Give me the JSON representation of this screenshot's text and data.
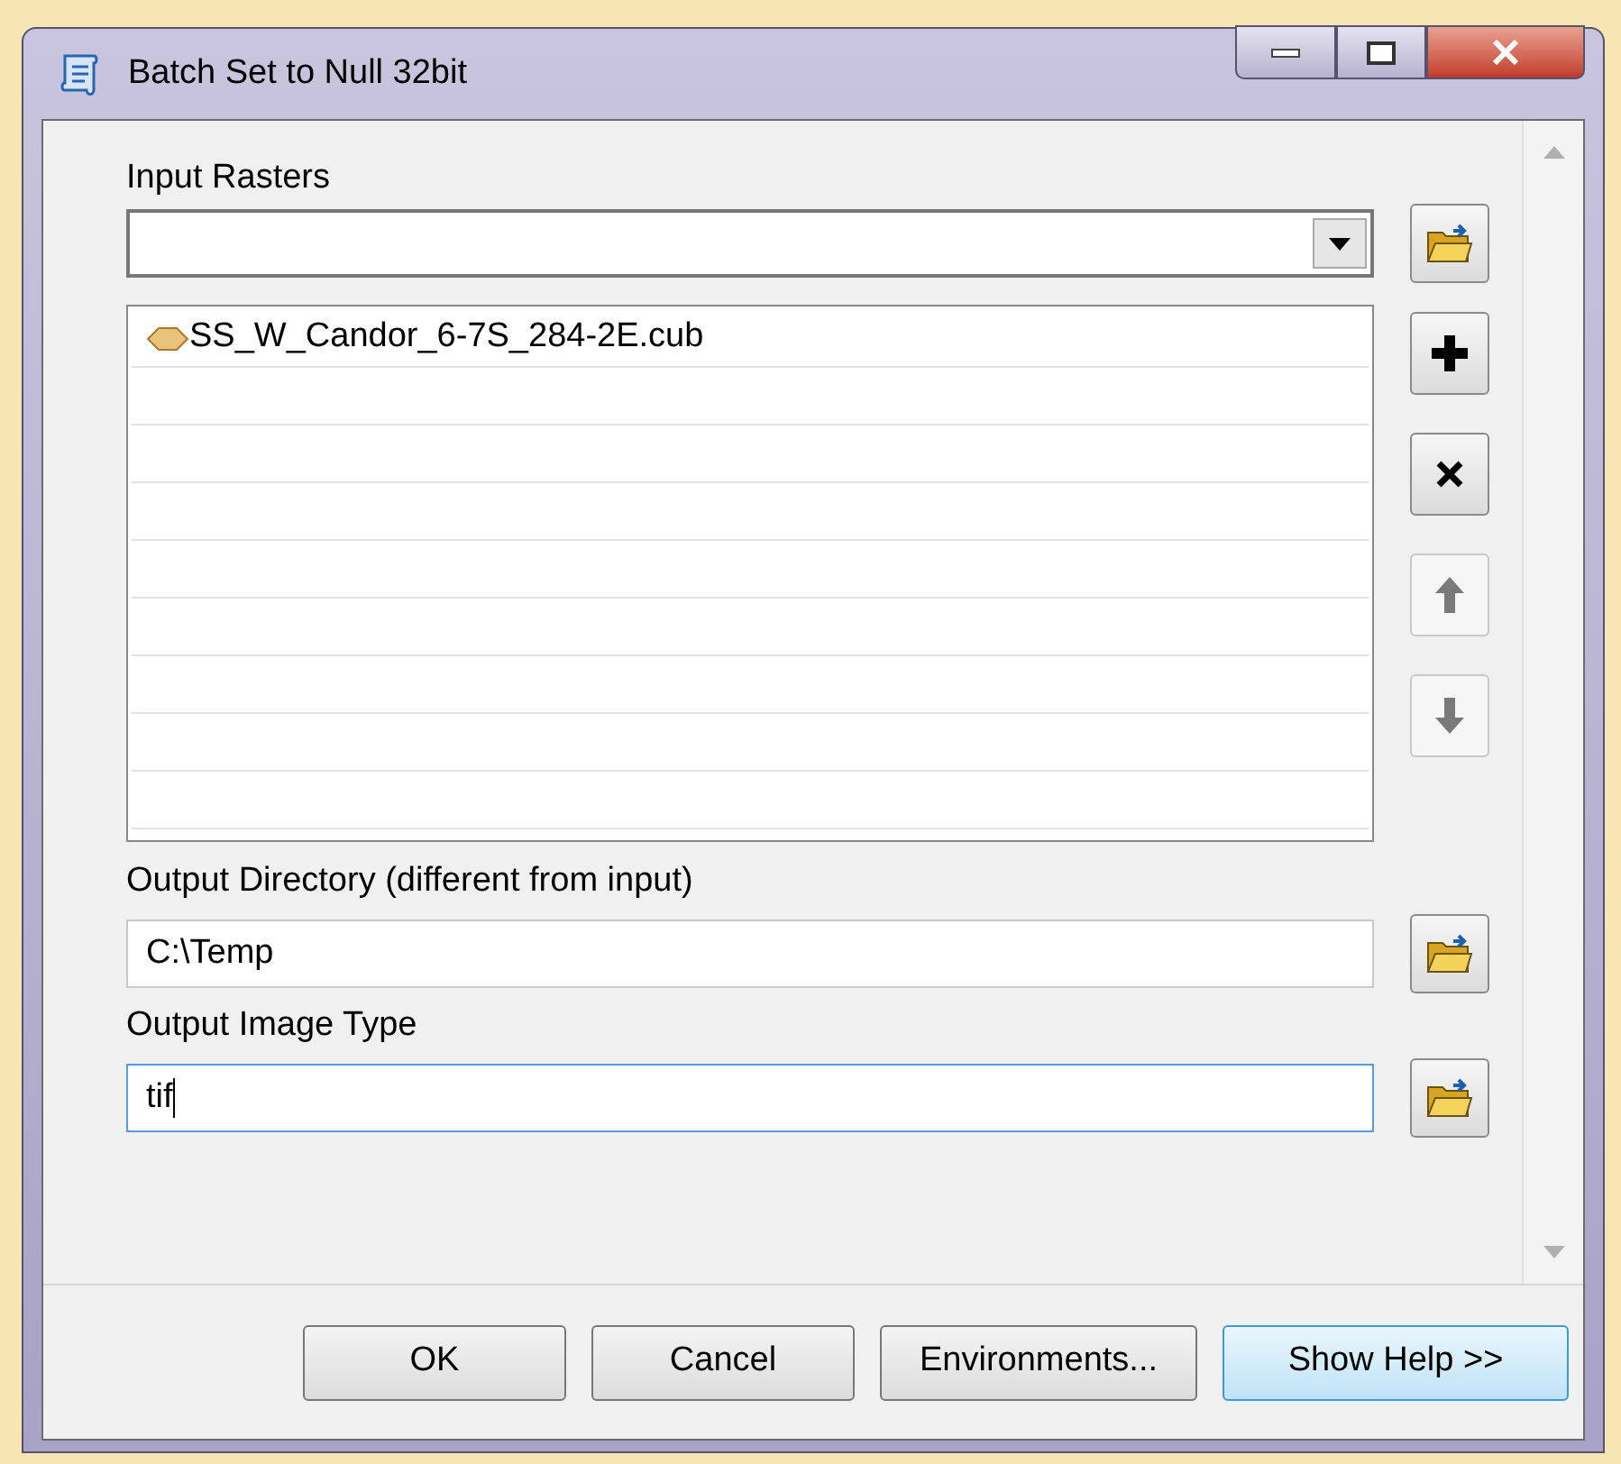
{
  "window": {
    "title": "Batch Set to Null 32bit"
  },
  "input_rasters": {
    "label": "Input Rasters",
    "items": [
      {
        "name": "SS_W_Candor_6-7S_284-2E.cub"
      }
    ],
    "list_buttons": [
      {
        "kind": "add",
        "disabled": false
      },
      {
        "kind": "remove",
        "disabled": false
      },
      {
        "kind": "up",
        "disabled": true
      },
      {
        "kind": "down",
        "disabled": true
      }
    ]
  },
  "output_directory": {
    "label": "Output Directory (different from input)",
    "value": "C:\\Temp",
    "focused": false
  },
  "output_image_type": {
    "label": "Output Image Type",
    "value": "tif",
    "focused": true
  },
  "buttons": [
    {
      "label": "OK",
      "focused": false
    },
    {
      "label": "Cancel",
      "focused": false
    },
    {
      "label": "Environments...",
      "focused": false
    },
    {
      "label": "Show Help >>",
      "focused": true
    }
  ]
}
